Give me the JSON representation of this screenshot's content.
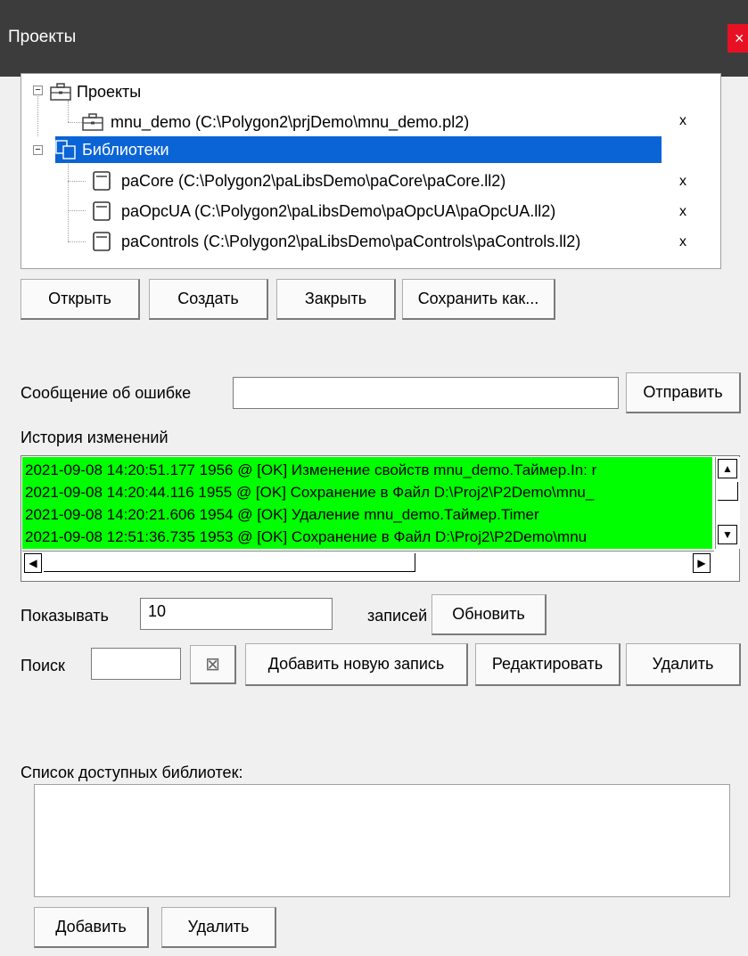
{
  "window": {
    "title": "Проекты",
    "close_glyph": "×"
  },
  "tree": {
    "items": [
      {
        "label": "Проекты",
        "icon": "briefcase-icon"
      },
      {
        "label": "mnu_demo (C:\\Polygon2\\prjDemo\\mnu_demo.pl2)",
        "icon": "briefcase-icon",
        "remove": "x"
      },
      {
        "label": "Библиотеки",
        "icon": "libraries-icon",
        "selected": true
      },
      {
        "label": "paCore (C:\\Polygon2\\paLibsDemo\\paCore\\paCore.ll2)",
        "icon": "library-icon",
        "remove": "x"
      },
      {
        "label": "paOpcUA (C:\\Polygon2\\paLibsDemo\\paOpcUA\\paOpcUA.ll2)",
        "icon": "library-icon",
        "remove": "x"
      },
      {
        "label": "paControls (C:\\Polygon2\\paLibsDemo\\paControls\\paControls.ll2)",
        "icon": "library-icon",
        "remove": "x"
      }
    ]
  },
  "project_buttons": {
    "open": "Открыть",
    "create": "Создать",
    "close": "Закрыть",
    "save_as": "Сохранить как..."
  },
  "error_report": {
    "label": "Сообщение об ошибке",
    "value": "",
    "send": "Отправить"
  },
  "history": {
    "label": "История изменений",
    "highlight_color": "#00ff00",
    "lines": [
      "2021-09-08 14:20:51.177 1956 @ [OK] Изменение свойств mnu_demo.Таймер.In: r",
      "2021-09-08 14:20:44.116 1955 @ [OK] Сохранение в Файл D:\\Proj2\\P2Demo\\mnu_",
      "2021-09-08 14:20:21.606 1954 @ [OK] Удаление mnu_demo.Таймер.Timer",
      "2021-09-08 12:51:36.735 1953 @ [OK] Сохранение в Файл D:\\Proj2\\P2Demo\\mnu"
    ]
  },
  "paging": {
    "show_label": "Показывать",
    "count": "10",
    "records_label": "записей",
    "refresh": "Обновить"
  },
  "search": {
    "label": "Поиск",
    "value": "",
    "clear_glyph": "⊠",
    "add_record": "Добавить новую запись",
    "edit": "Редактировать",
    "delete": "Удалить"
  },
  "available_libs": {
    "label": "Список доступных библиотек:",
    "add": "Добавить",
    "delete": "Удалить"
  }
}
